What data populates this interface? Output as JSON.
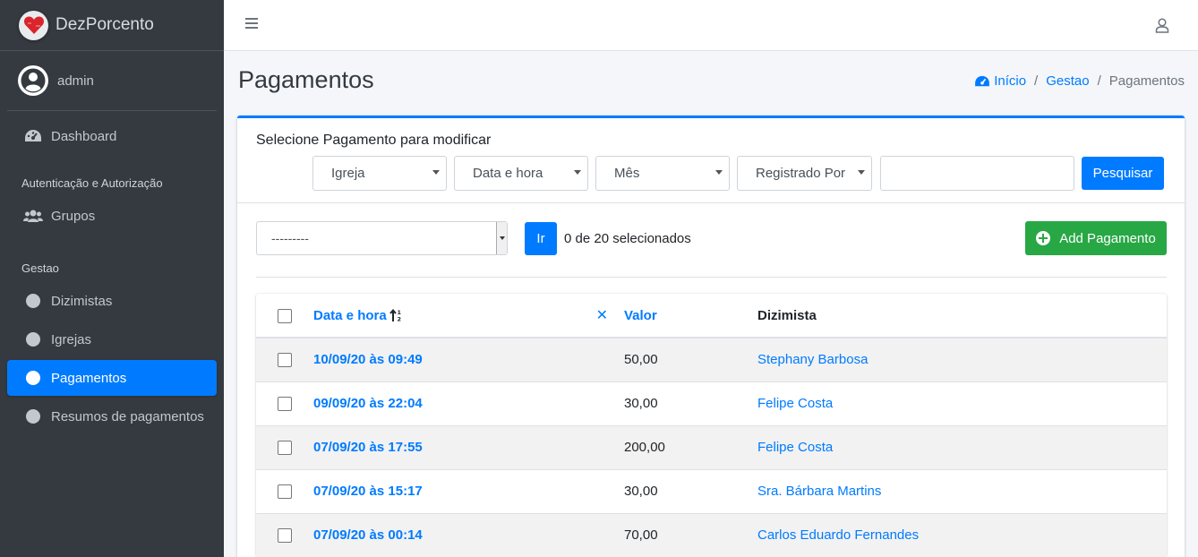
{
  "brand": {
    "name": "DezPorcento"
  },
  "user": {
    "name": "admin"
  },
  "sidebar": {
    "dashboard": "Dashboard",
    "auth_header": "Autenticação e Autorização",
    "groups": "Grupos",
    "gestao_header": "Gestao",
    "items": [
      {
        "label": "Dizimistas"
      },
      {
        "label": "Igrejas"
      },
      {
        "label": "Pagamentos"
      },
      {
        "label": "Resumos de pagamentos"
      }
    ]
  },
  "page": {
    "title": "Pagamentos"
  },
  "breadcrumb": {
    "home": "Início",
    "section": "Gestao",
    "current": "Pagamentos",
    "separator": "/"
  },
  "card": {
    "title": "Selecione Pagamento para modificar",
    "filters": [
      "Igreja",
      "Data e hora",
      "Mês",
      "Registrado Por"
    ],
    "search_value": "",
    "search_button": "Pesquisar"
  },
  "actions": {
    "select_value": "---------",
    "go_button": "Ir",
    "selected_count": "0 de 20 selecionados",
    "add_button": "Add Pagamento"
  },
  "table": {
    "headers": {
      "date": "Data e hora",
      "remove_sort": "✕",
      "valor": "Valor",
      "dizimista": "Dizimista"
    },
    "rows": [
      {
        "date": "10/09/20 às 09:49",
        "valor": "50,00",
        "dizimista": "Stephany Barbosa"
      },
      {
        "date": "09/09/20 às 22:04",
        "valor": "30,00",
        "dizimista": "Felipe Costa"
      },
      {
        "date": "07/09/20 às 17:55",
        "valor": "200,00",
        "dizimista": "Felipe Costa"
      },
      {
        "date": "07/09/20 às 15:17",
        "valor": "30,00",
        "dizimista": "Sra. Bárbara Martins"
      },
      {
        "date": "07/09/20 às 00:14",
        "valor": "70,00",
        "dizimista": "Carlos Eduardo Fernandes"
      }
    ]
  },
  "colors": {
    "primary": "#007bff",
    "success": "#28a745",
    "sidebar_bg": "#343a40",
    "striped_row": "#f2f2f2"
  },
  "icons": {
    "logo": "heart-logo-icon",
    "avatar": "user-circle-icon",
    "dashboard": "tachometer-icon",
    "groups": "users-icon",
    "menu": "bars-icon",
    "user": "user-outline-icon",
    "sort": "sort-ascending-icon",
    "add": "plus-circle-icon"
  }
}
